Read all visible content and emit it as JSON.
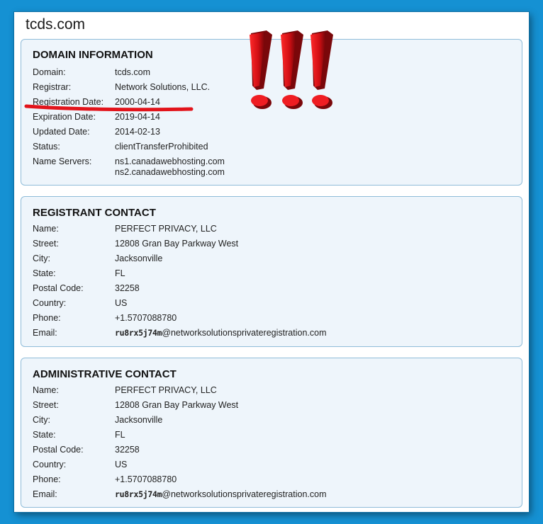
{
  "site": {
    "title": "tcds.com"
  },
  "domain_info": {
    "heading": "DOMAIN INFORMATION",
    "rows": [
      {
        "label": "Domain:",
        "value": "tcds.com"
      },
      {
        "label": "Registrar:",
        "value": "Network Solutions, LLC."
      },
      {
        "label": "Registration Date:",
        "value": "2000-04-14"
      },
      {
        "label": "Expiration Date:",
        "value": "2019-04-14"
      },
      {
        "label": "Updated Date:",
        "value": "2014-02-13"
      },
      {
        "label": "Status:",
        "value": "clientTransferProhibited"
      },
      {
        "label": "Name Servers:",
        "value": "ns1.canadawebhosting.com",
        "value2": "ns2.canadawebhosting.com"
      }
    ]
  },
  "registrant": {
    "heading": "REGISTRANT CONTACT",
    "rows": [
      {
        "label": "Name:",
        "value": "PERFECT PRIVACY, LLC"
      },
      {
        "label": "Street:",
        "value": "12808 Gran Bay Parkway West"
      },
      {
        "label": "City:",
        "value": "Jacksonville"
      },
      {
        "label": "State:",
        "value": "FL"
      },
      {
        "label": "Postal Code:",
        "value": "32258"
      },
      {
        "label": "Country:",
        "value": "US"
      },
      {
        "label": "Phone:",
        "value": "+1.5707088780"
      },
      {
        "label": "Email:",
        "email_user": "ru8rx5j74m",
        "email_domain": "@networksolutionsprivateregistration.com"
      }
    ]
  },
  "administrative": {
    "heading": "ADMINISTRATIVE CONTACT",
    "rows": [
      {
        "label": "Name:",
        "value": "PERFECT PRIVACY, LLC"
      },
      {
        "label": "Street:",
        "value": "12808 Gran Bay Parkway West"
      },
      {
        "label": "City:",
        "value": "Jacksonville"
      },
      {
        "label": "State:",
        "value": "FL"
      },
      {
        "label": "Postal Code:",
        "value": "32258"
      },
      {
        "label": "Country:",
        "value": "US"
      },
      {
        "label": "Phone:",
        "value": "+1.5707088780"
      },
      {
        "label": "Email:",
        "email_user": "ru8rx5j74m",
        "email_domain": "@networksolutionsprivateregistration.com"
      }
    ]
  },
  "annotations": {
    "highlight_color": "#e2141b",
    "exclamation_count": 3,
    "exclamation_icon": "exclamation-mark-icon"
  },
  "colors": {
    "background": "#1591d3",
    "panel_bg": "#eef5fb",
    "panel_border": "#8fbcd9"
  }
}
